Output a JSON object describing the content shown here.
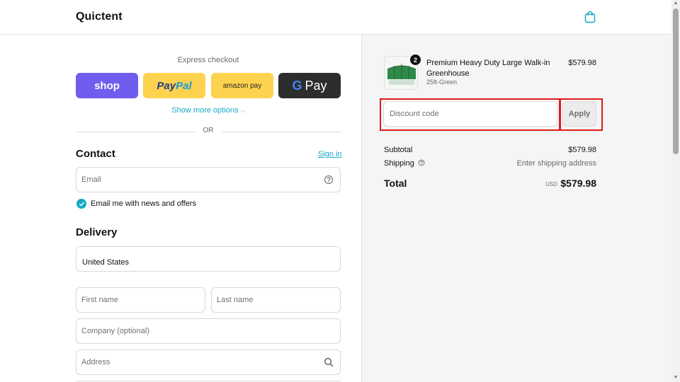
{
  "header": {
    "brand": "Quictent",
    "cart_icon": "shopping-bag-icon"
  },
  "express": {
    "label": "Express checkout",
    "shop_label": "shop",
    "paypal_part1": "Pay",
    "paypal_part2": "Pal",
    "amazon_label": "amazon pay",
    "gpay_g": "G",
    "gpay_label": "Pay",
    "show_more": "Show more options",
    "or_text": "OR"
  },
  "contact": {
    "title": "Contact",
    "signin": "Sign in",
    "email_placeholder": "Email",
    "email_value": "",
    "newsletter_label": "Email me with news and offers",
    "newsletter_checked": true
  },
  "delivery": {
    "title": "Delivery",
    "country": "United States",
    "first_name_placeholder": "First name",
    "last_name_placeholder": "Last name",
    "company_placeholder": "Company (optional)",
    "address_placeholder": "Address"
  },
  "order": {
    "product_name": "Premium Heavy Duty Large Walk-in Greenhouse",
    "product_variant": "25ft-Green",
    "product_price": "$579.98",
    "quantity": "2",
    "discount_placeholder": "Discount code",
    "discount_value": "",
    "apply_label": "Apply",
    "subtotal_label": "Subtotal",
    "subtotal_value": "$579.98",
    "shipping_label": "Shipping",
    "shipping_value": "Enter shipping address",
    "total_label": "Total",
    "total_currency": "USD",
    "total_value": "$579.98"
  },
  "colors": {
    "accent": "#16a9c7",
    "shop_purple": "#6e5dee",
    "paypal_yellow": "#fdd24f",
    "gpay_dark": "#2d2d2d",
    "highlight_red": "#e01b1b"
  }
}
